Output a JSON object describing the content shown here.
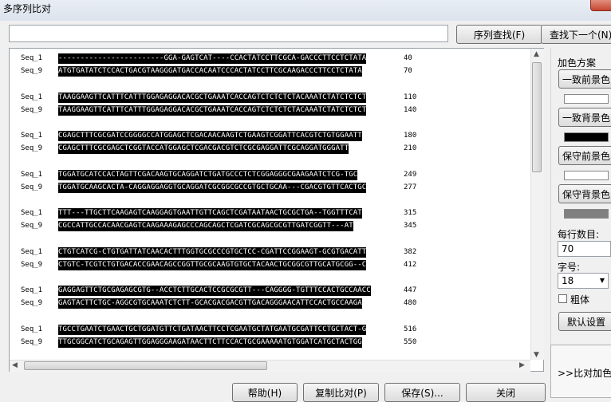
{
  "window": {
    "title": "多序列比对"
  },
  "search": {
    "placeholder": "",
    "value": "",
    "find_label": "序列查找(F)",
    "next_label": "查找下一个(N)"
  },
  "alignment": {
    "blocks": [
      {
        "rows": [
          {
            "name": "Seq_1",
            "seq": "------------------------GGA-GAGTCAT----CCACTATCCTTCGCA-GACCCTTCCTCTATA",
            "end": "40"
          },
          {
            "name": "Seq_9",
            "seq": "ATGTGATATCTCCACTGACGTAAGGGATGACCACAATCCCACTATCCTTCGCAAGACCCTTCCTCTATA",
            "end": "70"
          }
        ]
      },
      {
        "rows": [
          {
            "name": "Seq_1",
            "seq": "TAAGGAAGTTCATTTCATTTGGAGAGGACACGCTGAAATCACCAGTCTCTCTCTACAAATCTATCTCTCT",
            "end": "110"
          },
          {
            "name": "Seq_9",
            "seq": "TAAGGAAGTTCATTTCATTTGGAGAGGACACGCTGAAATCACCAGTCTCTCTCTACAAATCTATCTCTCT",
            "end": "140"
          }
        ]
      },
      {
        "rows": [
          {
            "name": "Seq_1",
            "seq": "CGAGCTTTCGCGATCCGGGGCCATGGAGCTCGACAACAAGTCTGAAGTCGGATTCACGTCTGTGGAATT",
            "end": "180"
          },
          {
            "name": "Seq_9",
            "seq": "CGAGCTTTCGCGAGCTCGGTACCATGGAGCTCGACGACGTCTCGCGAGGATTCGCAGGATGGGATT",
            "end": "210"
          }
        ]
      },
      {
        "rows": [
          {
            "name": "Seq_1",
            "seq": "TGGATGCATCCACTAGTTCGACAAGTGCAGGATCTGATGCCCTCTCGGAGGGCGAAGAATCTCG-TGC",
            "end": "249"
          },
          {
            "name": "Seq_9",
            "seq": "TGGATGCAAGCACTA-CAGGAGGAGGTGCAGGATCGCGGCGCCGTGCTGCAA---CGACGTGTTCACTGC",
            "end": "277"
          }
        ]
      },
      {
        "rows": [
          {
            "name": "Seq_1",
            "seq": "TTT---TTGCTTCAAGAGTCAAGGAGTGAATTGTTCAGCTCGATAATAACTGCGCTGA--TGGTTTCAT",
            "end": "315"
          },
          {
            "name": "Seq_9",
            "seq": "CGCCATTGCCACAACGAGTCAAGAAAGAGCCCAGCAGCTCGATCGCAGCGCGTTGATCGGTT---AT",
            "end": "345"
          }
        ]
      },
      {
        "rows": [
          {
            "name": "Seq_1",
            "seq": "CTGTCATCG-CTGTGATTATCAACACTTTGGTGCGCCCGTGCTCC-CGATTCCGGAAGT-GCGTGACATT",
            "end": "382"
          },
          {
            "name": "Seq_9",
            "seq": "CTGTC-TCGTCTGTGACACCGAACAGCCGGTTGCGCAAGTGTGCTACAACTGCGGCGTTGCATGCGG--C",
            "end": "412"
          }
        ]
      },
      {
        "rows": [
          {
            "name": "Seq_1",
            "seq": "GAGGAGTTCTGCGAGAGCGTG--ACCTCTTGCACTCCGCGCGTT---CAGGGG-TGTTTCCACTGCCAACC",
            "end": "447"
          },
          {
            "name": "Seq_9",
            "seq": "GAGTACTTCTGC-AGGCGTGCAAATCTCTT-GCACGACGACGTTGACAGGGAACATTCCACTGCCAAGA",
            "end": "480"
          }
        ]
      },
      {
        "rows": [
          {
            "name": "Seq_1",
            "seq": "TGCCTGAATCTGAACTGCTGGATGTTCTGATAACTTCCTCGAATGCTATGAATGCGATTCCTGCTACT-G",
            "end": "516"
          },
          {
            "name": "Seq_9",
            "seq": "TTGCGGCATCTGCAGAGTTGGAGGGAAGATAACTTCTTCCACTGCGAAAAATGTGGATCATGCTACTGG",
            "end": "550"
          }
        ]
      }
    ]
  },
  "bottom": {
    "help": "帮助(H)",
    "copy": "复制比对(P)",
    "save": "保存(S)...",
    "close": "关闭"
  },
  "side": {
    "scheme_title": "加色方案",
    "consistent_fg": "一致前景色",
    "consistent_bg": "一致背景色",
    "conserve_fg": "保守前景色",
    "conserve_bg": "保守背景色",
    "rows_label": "每行数目:",
    "rows_value": "70",
    "font_label": "字号:",
    "font_value": "18",
    "bold_label": "粗体",
    "default_label": "默认设置",
    "expand_label": ">>比对加色"
  },
  "colors": {
    "consistent_fg": "#ffffff",
    "consistent_bg": "#000000",
    "conserve_fg": "#ffffff",
    "conserve_bg": "#808080"
  }
}
